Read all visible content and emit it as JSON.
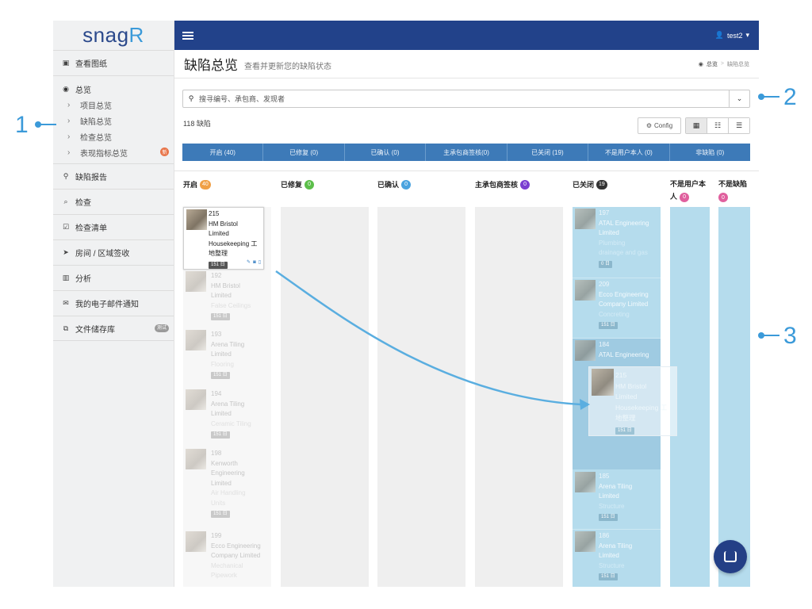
{
  "app": {
    "logo_main": "snag",
    "logo_accent": "R"
  },
  "sidebar": {
    "view_drawings": "查看图纸",
    "overview": "总览",
    "overview_items": [
      "项目总览",
      "缺陷总览",
      "检查总览",
      "表现指标总览"
    ],
    "new_badge": "新",
    "defect_report": "缺陷报告",
    "inspection": "检查",
    "checklist": "检查清单",
    "room_signoff": "房间 / 区域签收",
    "analysis": "分析",
    "email_notify": "我的电子邮件通知",
    "file_store": "文件储存库",
    "test_badge": "测试"
  },
  "topbar": {
    "user": "test2"
  },
  "header": {
    "title": "缺陷总览",
    "subtitle": "查看并更新您的缺陷状态",
    "breadcrumb_home": "总览",
    "breadcrumb_current": "缺陷总览"
  },
  "search": {
    "placeholder": "搜寻编号、承包商、发现者"
  },
  "toolbar": {
    "count": "118 缺陷",
    "config_label": "Config"
  },
  "status_tabs": [
    "开启 (40)",
    "已修复 (0)",
    "已确认 (0)",
    "主承包商签核(0)",
    "已关闭 (19)",
    "不是用户本人 (0)",
    "非缺陷 (0)"
  ],
  "columns": [
    {
      "title": "开启",
      "count": "40",
      "color": "#f0a046"
    },
    {
      "title": "已修复",
      "count": "0",
      "color": "#5cbf4a"
    },
    {
      "title": "已确认",
      "count": "0",
      "color": "#4aa3df"
    },
    {
      "title": "主承包商签核",
      "count": "0",
      "color": "#7a3fd0"
    },
    {
      "title": "已关闭",
      "count": "19",
      "color": "#333333"
    },
    {
      "title": "不是用户本",
      "title2": "人",
      "count": "0",
      "color": "#e0609e"
    },
    {
      "title": "不是缺陷",
      "count": "0",
      "color": "#e0609e"
    }
  ],
  "open_cards": [
    {
      "num": "215",
      "company": [
        "HM Bristol",
        "Limited"
      ],
      "task": [
        "Housekeeping 工",
        "地整理"
      ],
      "tag": "151 日"
    },
    {
      "num": "192",
      "company": [
        "HM Bristol",
        "Limited"
      ],
      "task": [
        "False Ceilings"
      ],
      "tag": "151 日"
    },
    {
      "num": "193",
      "company": [
        "Arena Tiling",
        "Limited"
      ],
      "task": [
        "Flooring"
      ],
      "tag": "151 日"
    },
    {
      "num": "194",
      "company": [
        "Arena Tiling",
        "Limited"
      ],
      "task": [
        "Ceramic Tiling"
      ],
      "tag": "151 日"
    },
    {
      "num": "198",
      "company": [
        "Kenworth",
        "Engineering",
        "Limited"
      ],
      "task": [
        "Air Handling",
        "Units"
      ],
      "tag": "151 日"
    },
    {
      "num": "199",
      "company": [
        "Ecco Engineering",
        "Company Limited"
      ],
      "task": [
        "Mechanical",
        "Pipework"
      ],
      "tag": ""
    }
  ],
  "closed_cards": [
    {
      "num": "197",
      "company": [
        "ATAL Engineering",
        "Limited"
      ],
      "task": [
        "Plumbing",
        "drainage and gas"
      ],
      "tag": "0 日"
    },
    {
      "num": "209",
      "company": [
        "Ecco Engineering",
        "Company Limited"
      ],
      "task": [
        "Concreting"
      ],
      "tag": "151 日"
    },
    {
      "num": "184",
      "company": [
        "ATAL Engineering"
      ],
      "task": [],
      "tag": ""
    },
    {
      "num": "185",
      "company": [
        "Arena Tiling",
        "Limited"
      ],
      "task": [
        "Structure"
      ],
      "tag": "151 日"
    },
    {
      "num": "186",
      "company": [
        "Arena Tiling",
        "Limited"
      ],
      "task": [
        "Structure"
      ],
      "tag": "151 日"
    }
  ],
  "drag_card": {
    "num": "215",
    "company": [
      "HM Bristol",
      "Limited"
    ],
    "task": [
      "Housekeeping 工",
      "地整理"
    ],
    "tag": "151 日"
  },
  "callouts": [
    "1",
    "2",
    "3"
  ]
}
